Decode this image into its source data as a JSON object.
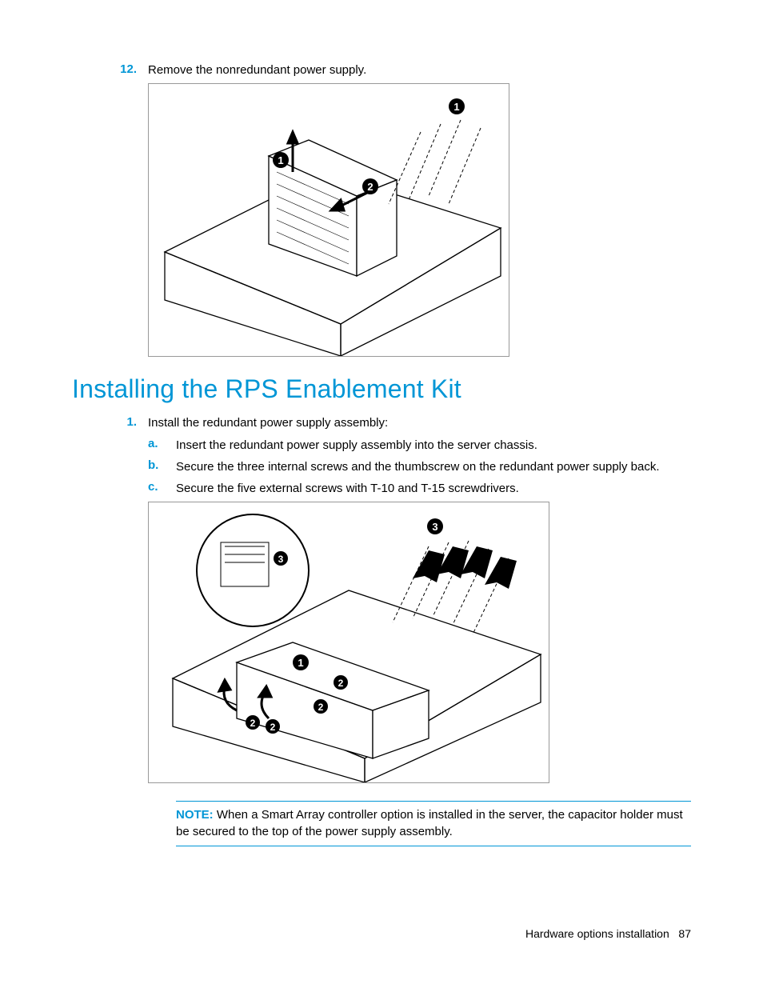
{
  "step12": {
    "number": "12.",
    "text": "Remove the nonredundant power supply."
  },
  "heading": "Installing the RPS Enablement Kit",
  "step1": {
    "number": "1.",
    "text": "Install the redundant power supply assembly:"
  },
  "substeps": [
    {
      "letter": "a.",
      "text": "Insert the redundant power supply assembly into the server chassis."
    },
    {
      "letter": "b.",
      "text": "Secure the three internal screws and the thumbscrew on the redundant power supply back."
    },
    {
      "letter": "c.",
      "text": "Secure the five external screws with T-10 and T-15 screwdrivers."
    }
  ],
  "note": {
    "label": "NOTE:",
    "text": " When a Smart Array controller option is installed in the server, the capacitor holder must be secured to the top of the power supply assembly."
  },
  "footer": {
    "section": "Hardware options installation",
    "page": "87"
  },
  "figures": {
    "fig1_alt": "Server chassis diagram showing power supply removal with callouts 1 and 2",
    "fig2_alt": "Server chassis diagram showing RPS installation with callouts 1, 2, and 3"
  }
}
